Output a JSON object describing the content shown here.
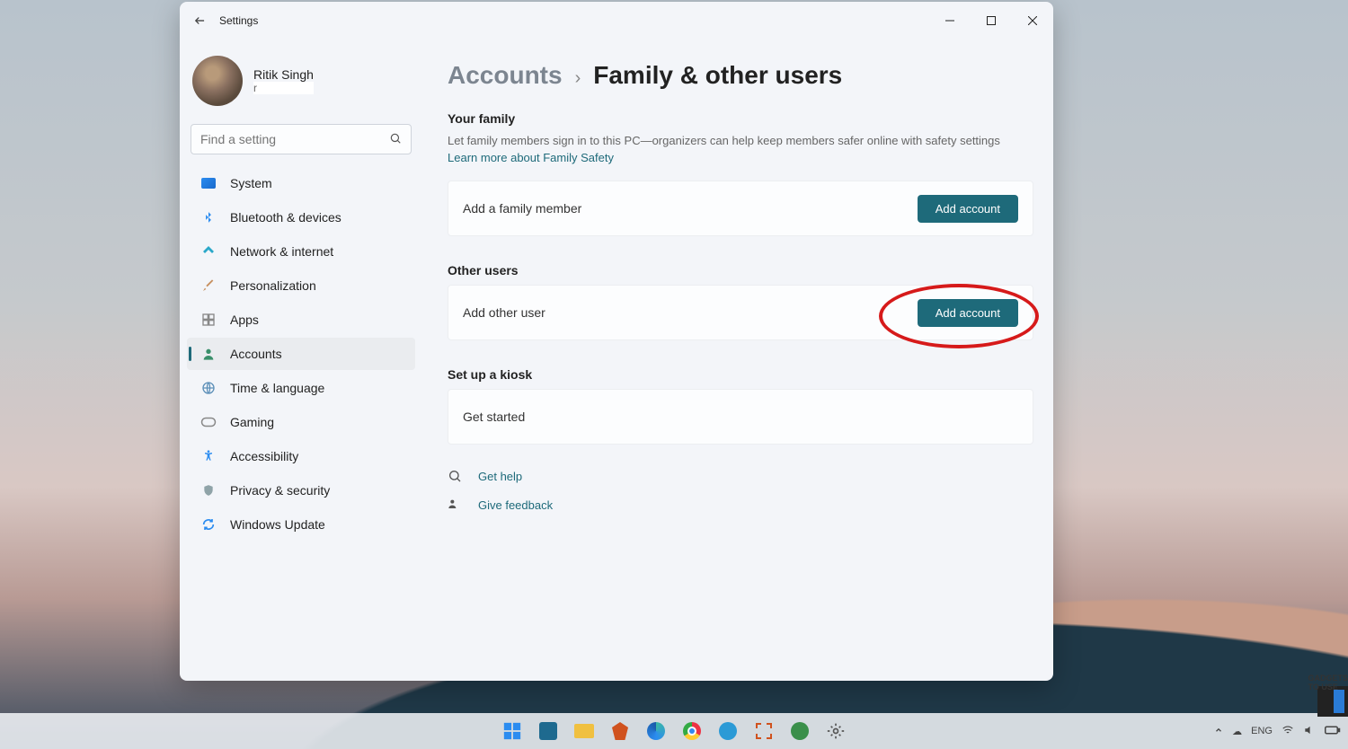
{
  "window": {
    "title": "Settings"
  },
  "user": {
    "name": "Ritik Singh",
    "email_preview": "r"
  },
  "search": {
    "placeholder": "Find a setting"
  },
  "sidebar": {
    "items": [
      {
        "label": "System"
      },
      {
        "label": "Bluetooth & devices"
      },
      {
        "label": "Network & internet"
      },
      {
        "label": "Personalization"
      },
      {
        "label": "Apps"
      },
      {
        "label": "Accounts"
      },
      {
        "label": "Time & language"
      },
      {
        "label": "Gaming"
      },
      {
        "label": "Accessibility"
      },
      {
        "label": "Privacy & security"
      },
      {
        "label": "Windows Update"
      }
    ]
  },
  "breadcrumb": {
    "root": "Accounts",
    "current": "Family & other users"
  },
  "family": {
    "title": "Your family",
    "desc": "Let family members sign in to this PC—organizers can help keep members safer online with safety settings",
    "learn_more": "Learn more about Family Safety",
    "card_label": "Add a family member",
    "card_action": "Add account"
  },
  "other_users": {
    "title": "Other users",
    "card_label": "Add other user",
    "card_action": "Add account"
  },
  "kiosk": {
    "title": "Set up a kiosk",
    "card_label": "Get started"
  },
  "help": {
    "get_help": "Get help",
    "feedback": "Give feedback"
  },
  "taskbar": {
    "lang": "ENG"
  },
  "watermark": {
    "text": "GADGETS TO USE"
  }
}
